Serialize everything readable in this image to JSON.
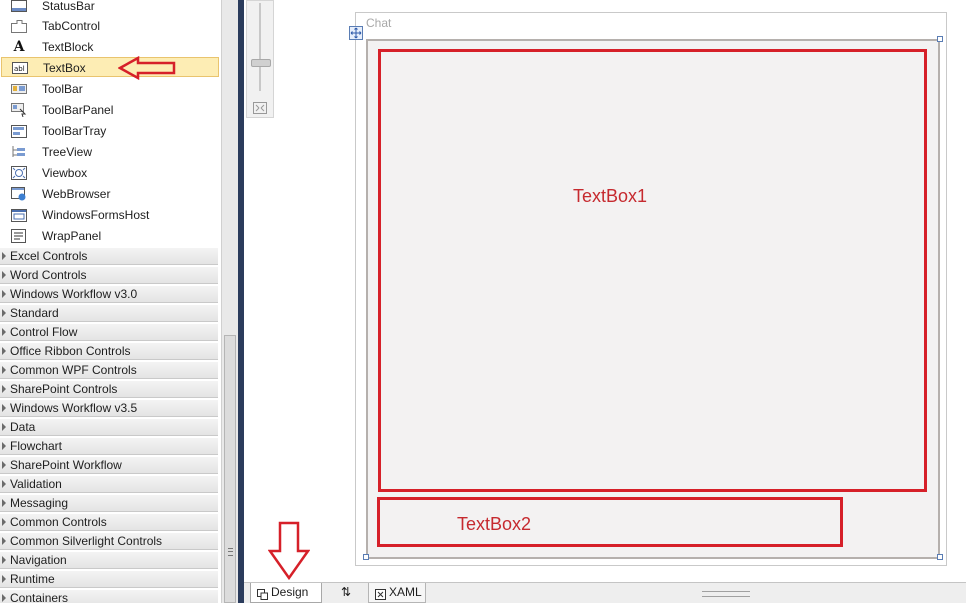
{
  "toolbox": {
    "items": [
      {
        "label": "StatusBar",
        "icon": "statusbar-icon"
      },
      {
        "label": "TabControl",
        "icon": "tabcontrol-icon"
      },
      {
        "label": "TextBlock",
        "icon": "textblock-icon"
      },
      {
        "label": "TextBox",
        "icon": "textbox-icon",
        "selected": true
      },
      {
        "label": "ToolBar",
        "icon": "toolbar-icon"
      },
      {
        "label": "ToolBarPanel",
        "icon": "toolbarpanel-icon"
      },
      {
        "label": "ToolBarTray",
        "icon": "toolbartray-icon"
      },
      {
        "label": "TreeView",
        "icon": "treeview-icon"
      },
      {
        "label": "Viewbox",
        "icon": "viewbox-icon"
      },
      {
        "label": "WebBrowser",
        "icon": "webbrowser-icon"
      },
      {
        "label": "WindowsFormsHost",
        "icon": "windowsformshost-icon"
      },
      {
        "label": "WrapPanel",
        "icon": "wrappanel-icon"
      }
    ],
    "categories": [
      "Excel Controls",
      "Word Controls",
      "Windows Workflow v3.0",
      "Standard",
      "Control Flow",
      "Office Ribbon Controls",
      "Common WPF Controls",
      "SharePoint Controls",
      "Windows Workflow v3.5",
      "Data",
      "Flowchart",
      "SharePoint Workflow",
      "Validation",
      "Messaging",
      "Common Controls",
      "Common Silverlight Controls",
      "Navigation",
      "Runtime",
      "Containers"
    ]
  },
  "designer": {
    "window_title": "Chat",
    "textbox1_label": "TextBox1",
    "textbox2_label": "TextBox2"
  },
  "tabs": {
    "design": "Design",
    "swap_symbol": "⇅",
    "xaml": "XAML"
  },
  "colors": {
    "annotation_red": "#d62029",
    "selection_fill": "#fdedb4",
    "splitter": "#2b3c5c"
  }
}
